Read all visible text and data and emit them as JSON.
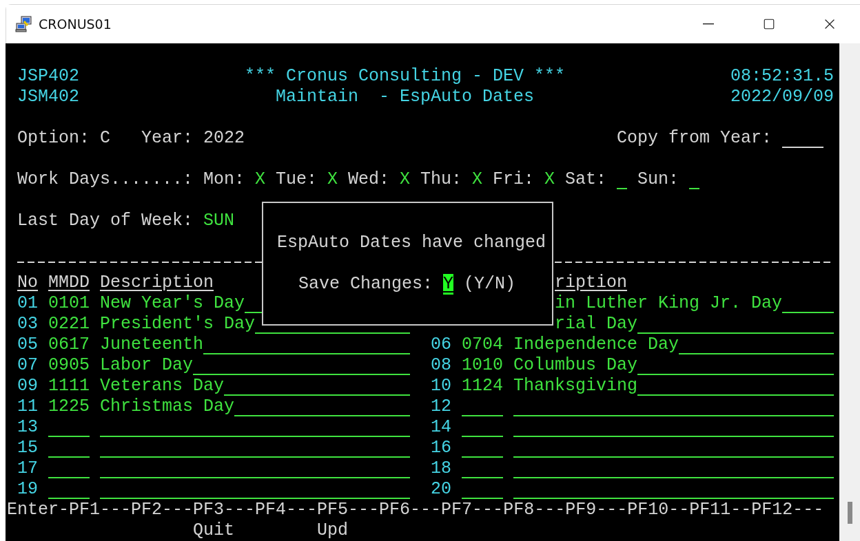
{
  "window": {
    "title": "CRONUS01"
  },
  "header": {
    "program": "JSP402",
    "map": "JSM402",
    "banner": "*** Cronus Consulting - DEV ***",
    "screen_title": "Maintain  - EspAuto Dates",
    "time": "08:52:31.5",
    "date": "2022/09/09"
  },
  "selection": {
    "option_label": "Option:",
    "option": "C",
    "year_label": "Year:",
    "year": "2022",
    "copy_label": "Copy from Year:"
  },
  "work_days": {
    "label": "Work Days.......:",
    "days": [
      {
        "label": "Mon:",
        "value": "X"
      },
      {
        "label": "Tue:",
        "value": "X"
      },
      {
        "label": "Wed:",
        "value": "X"
      },
      {
        "label": "Thu:",
        "value": "X"
      },
      {
        "label": "Fri:",
        "value": "X"
      },
      {
        "label": "Sat:"
      },
      {
        "label": "Sun:"
      }
    ]
  },
  "last_day": {
    "label": "Last Day of Week:",
    "value": "SUN"
  },
  "columns_left": [
    "No",
    "MMDD",
    "Description"
  ],
  "columns_right": [
    "ription"
  ],
  "holidays_left": [
    {
      "no": "01",
      "mmdd": "0101",
      "description": "New Year's Day"
    },
    {
      "no": "03",
      "mmdd": "0221",
      "description": "President's Day"
    },
    {
      "no": "05",
      "mmdd": "0617",
      "description": "Juneteenth"
    },
    {
      "no": "07",
      "mmdd": "0905",
      "description": "Labor Day"
    },
    {
      "no": "09",
      "mmdd": "1111",
      "description": "Veterans Day"
    },
    {
      "no": "11",
      "mmdd": "1225",
      "description": "Christmas Day"
    },
    {
      "no": "13"
    },
    {
      "no": "15"
    },
    {
      "no": "17"
    },
    {
      "no": "19"
    }
  ],
  "holidays_right": [
    {
      "description": "in Luther King Jr. Day"
    },
    {
      "description": "rial Day"
    },
    {
      "no": "06",
      "mmdd": "0704",
      "description": "Independence Day"
    },
    {
      "no": "08",
      "mmdd": "1010",
      "description": "Columbus Day"
    },
    {
      "no": "10",
      "mmdd": "1124",
      "description": "Thanksgiving"
    },
    {
      "no": "12"
    },
    {
      "no": "14"
    },
    {
      "no": "16"
    },
    {
      "no": "18"
    },
    {
      "no": "20"
    }
  ],
  "dialog": {
    "message": "EspAuto Dates have changed",
    "prompt": "Save Changes:",
    "answer": "Y",
    "choices": "(Y/N)"
  },
  "function_keys": [
    {
      "key": "Enter-"
    },
    {
      "key": "PF1---"
    },
    {
      "key": "PF2---"
    },
    {
      "key": "PF3---",
      "label": "Quit"
    },
    {
      "key": "PF4---"
    },
    {
      "key": "PF5---",
      "label": "Upd"
    },
    {
      "key": "PF6---"
    },
    {
      "key": "PF7---"
    },
    {
      "key": "PF8---"
    },
    {
      "key": "PF9---"
    },
    {
      "key": "PF10--"
    },
    {
      "key": "PF11--"
    },
    {
      "key": "PF12---"
    }
  ]
}
